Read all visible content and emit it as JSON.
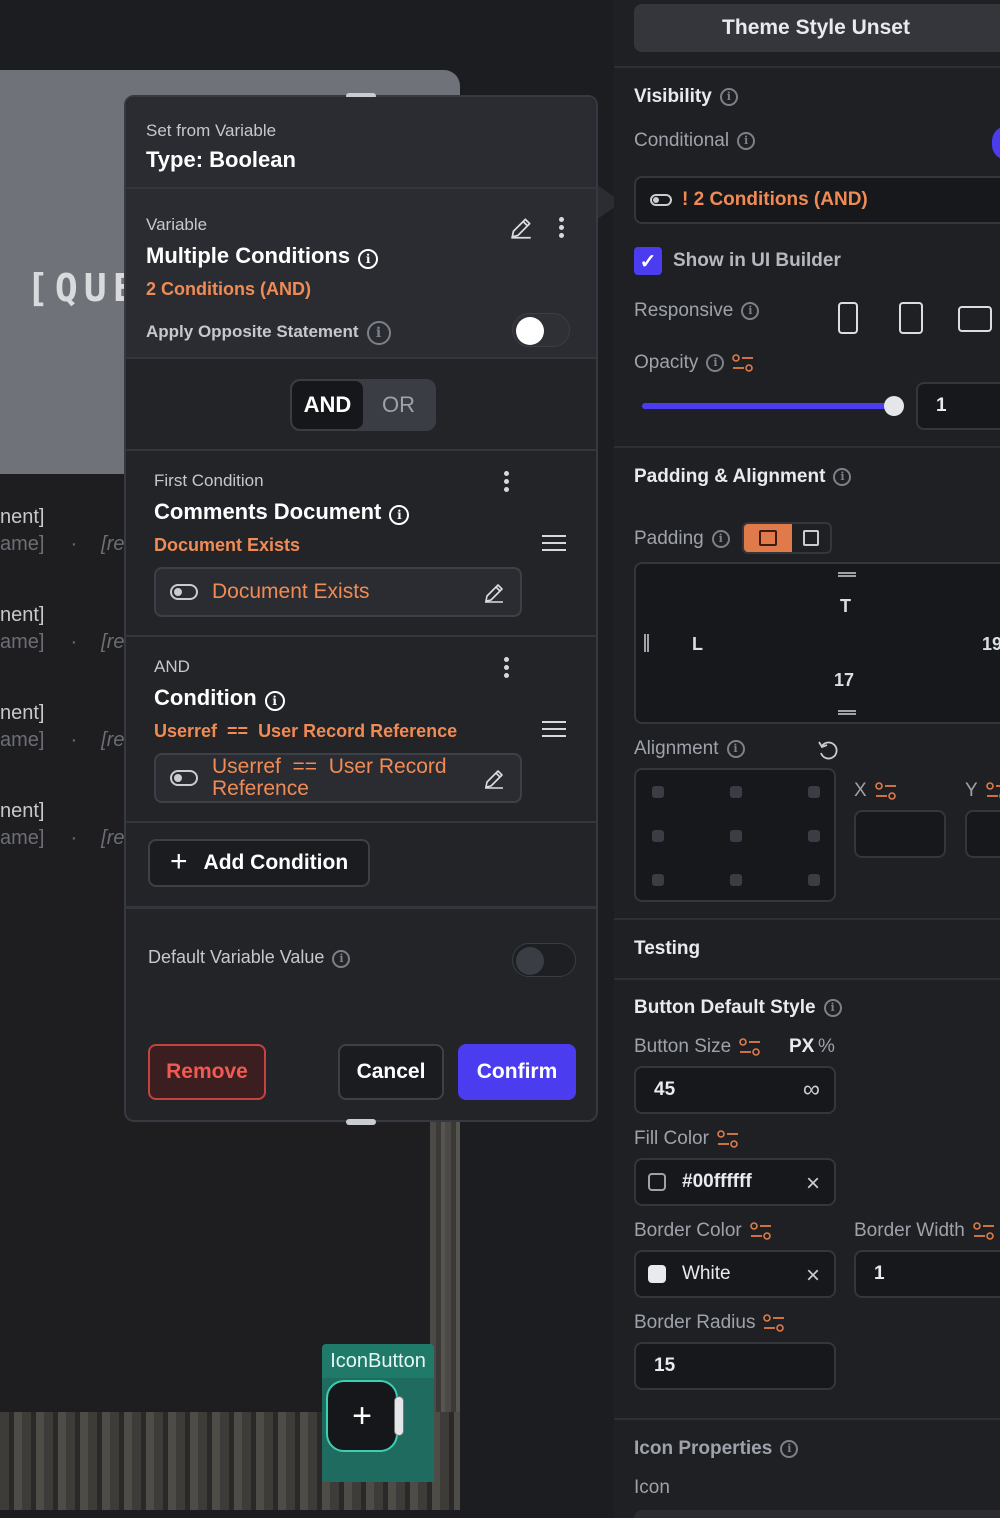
{
  "canvas": {
    "question_text": "[QUES",
    "list_items": [
      {
        "line1": "nent]",
        "line2": "ame]",
        "dot": "·",
        "ref": "[re"
      },
      {
        "line1": "nent]",
        "line2": "ame]",
        "dot": "·",
        "ref": "[re"
      },
      {
        "line1": "nent]",
        "line2": "ame]",
        "dot": "·",
        "ref": "[re"
      },
      {
        "line1": "nent]",
        "line2": "ame]",
        "dot": "·",
        "ref": "[re"
      }
    ],
    "icon_button_tag": "IconButton",
    "icon_button_glyph": "+"
  },
  "popup": {
    "header_label": "Set from Variable",
    "header_type": "Type: Boolean",
    "variable_label": "Variable",
    "variable_title": "Multiple Conditions",
    "variable_summary": "2 Conditions (AND)",
    "apply_opposite_label": "Apply Opposite Statement",
    "apply_opposite_on": true,
    "logic": {
      "and_label": "AND",
      "or_label": "OR",
      "selected": "AND"
    },
    "conditions": [
      {
        "label": "First Condition",
        "title": "Comments Document",
        "summary": "Document Exists",
        "field_value": "Document Exists"
      },
      {
        "label": "AND",
        "title": "Condition",
        "summary": "Userref  ==  User Record Reference",
        "field_value": "Userref  ==  User Record Reference"
      }
    ],
    "add_condition_label": "Add Condition",
    "default_value_label": "Default Variable Value",
    "default_value_on": false,
    "remove_label": "Remove",
    "cancel_label": "Cancel",
    "confirm_label": "Confirm"
  },
  "panel": {
    "theme_style_label": "Theme Style Unset",
    "visibility_label": "Visibility",
    "conditional_label": "Conditional",
    "condition_chip": "! 2 Conditions (AND)",
    "show_in_ui_builder_label": "Show in UI Builder",
    "show_in_ui_builder_checked": true,
    "responsive_label": "Responsive",
    "opacity_label": "Opacity",
    "opacity_value": "1",
    "padding_alignment_label": "Padding & Alignment",
    "padding_label": "Padding",
    "padding_top_label": "T",
    "padding_left_label": "L",
    "padding_right_value": "19",
    "padding_bottom_value": "17",
    "alignment_label": "Alignment",
    "x_label": "X",
    "y_label": "Y",
    "testing_label": "Testing",
    "button_default_style_label": "Button Default Style",
    "button_size_label": "Button Size",
    "unit_px": "PX",
    "unit_percent": "%",
    "button_size_value": "45",
    "infinity_symbol": "∞",
    "fill_color_label": "Fill Color",
    "fill_color_value": "#00ffffff",
    "border_color_label": "Border Color",
    "border_color_value": "White",
    "border_width_label": "Border Width",
    "border_width_value": "1",
    "border_radius_label": "Border Radius",
    "border_radius_value": "15",
    "icon_properties_label": "Icon Properties",
    "icon_label": "Icon"
  },
  "colors": {
    "accent": "#4b3cf0",
    "orange": "#f08b55",
    "danger": "#f05a52"
  }
}
